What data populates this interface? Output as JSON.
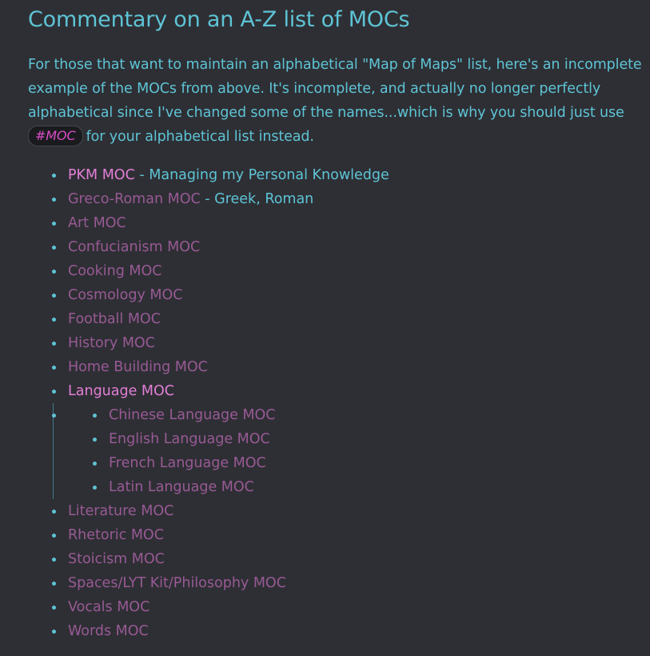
{
  "heading": "Commentary on an A-Z list of MOCs",
  "intro": {
    "text": "For those that want to maintain an alphabetical \"Map of Maps\" list, here's an incomplete example of the MOCs from above. It's incomplete, and actually no longer perfectly alphabetical since I've changed some of the names...which is why you should just use",
    "tag": "#MOC",
    "tail": "for your alphabetical list instead."
  },
  "list": {
    "pkm": {
      "link": "PKM MOC",
      "sep": " - ",
      "desc": "Managing my Personal Knowledge"
    },
    "greco": {
      "link": "Greco-Roman MOC",
      "sep": " - ",
      "desc": "Greek, Roman"
    },
    "art": "Art MOC",
    "confucianism": "Confucianism MOC",
    "cooking": "Cooking MOC",
    "cosmology": "Cosmology MOC",
    "football": "Football MOC",
    "history": "History MOC",
    "home_building": "Home Building MOC",
    "language": "Language MOC",
    "language_sub": {
      "chinese": "Chinese Language MOC",
      "english": "English Language MOC",
      "french": "French Language MOC",
      "latin": "Latin Language MOC"
    },
    "literature": "Literature MOC",
    "rhetoric": "Rhetoric MOC",
    "stoicism": "Stoicism MOC",
    "spaces": "Spaces/LYT Kit/Philosophy MOC",
    "vocals": "Vocals MOC",
    "words": "Words MOC"
  },
  "colors": {
    "background": "#2e2f34",
    "accent_cyan": "#5ec4d6",
    "link_resolved": "#e27fd6",
    "link_unresolved": "#985a95",
    "tag": "#d94dc6"
  }
}
